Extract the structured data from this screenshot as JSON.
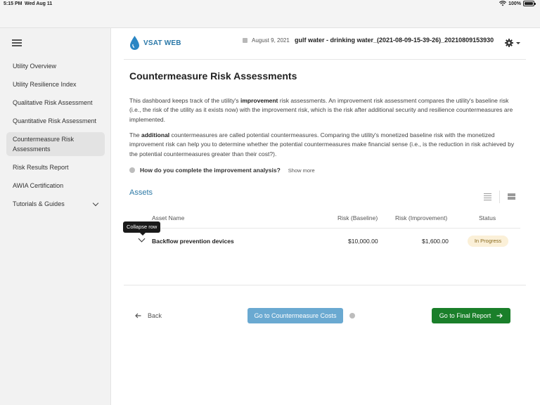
{
  "status_bar": {
    "time": "5:15 PM",
    "date": "Wed Aug 11",
    "battery": "100%"
  },
  "sidebar": {
    "items": [
      {
        "label": "Utility Overview"
      },
      {
        "label": "Utility Resilience Index"
      },
      {
        "label": "Qualitative Risk Assessment"
      },
      {
        "label": "Quantitative Risk Assessment"
      },
      {
        "label": "Countermeasure Risk Assessments"
      },
      {
        "label": "Risk Results Report"
      },
      {
        "label": "AWIA Certification"
      },
      {
        "label": "Tutorials & Guides"
      }
    ]
  },
  "header": {
    "logo_text": "VSAT WEB",
    "date": "August 9, 2021",
    "file_name": "gulf water - drinking water_(2021-08-09-15-39-26)_20210809153930"
  },
  "page": {
    "title": "Countermeasure Risk Assessments",
    "para1": {
      "a": "This dashboard keeps track of the utility's ",
      "b": "improvement",
      "c": " risk assessments. An improvement risk assessment compares the utility's baseline risk (i.e., the risk of the utility as it exists now) with the improvement risk, which is the risk after additional security and resilience countermeasures are implemented."
    },
    "para2": {
      "a": "The ",
      "b": "additional",
      "c": " countermeasures are called potential countermeasures. Comparing the utility's monetized baseline risk with the monetized improvement risk can help you to determine whether the potential countermeasures make financial sense (i.e., is the reduction in risk achieved by the potential countermeasures greater than their cost?)."
    },
    "howto_question": "How do you complete the improvement analysis?",
    "show_more": "Show more"
  },
  "assets": {
    "title": "Assets",
    "columns": [
      "Asset Name",
      "Risk (Baseline)",
      "Risk (Improvement)",
      "Status"
    ],
    "rows": [
      {
        "name": "Backflow prevention devices",
        "baseline": "$10,000.00",
        "improvement": "$1,600.00",
        "status": "In Progress"
      }
    ],
    "tooltip": "Collapse row"
  },
  "footer": {
    "back_label": "Back",
    "costs_label": "Go to Countermeasure Costs",
    "final_label": "Go to Final Report"
  },
  "colors": {
    "accent": "#2e7aa6",
    "costs_button": "#6aa9d1",
    "final_button": "#1a7f2a",
    "status_badge_bg": "#fbf0d8"
  }
}
